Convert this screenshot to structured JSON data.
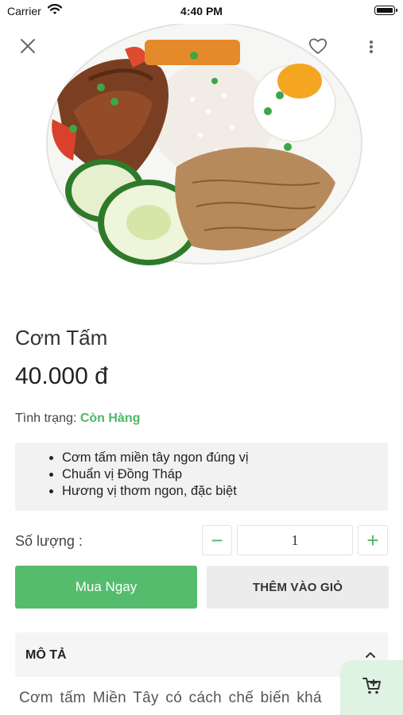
{
  "status_bar": {
    "carrier": "Carrier",
    "time": "4:40 PM"
  },
  "product": {
    "name": "Cơm Tấm",
    "price": "40.000 đ",
    "stock_label": "Tình trạng: ",
    "stock_value": "Còn Hàng",
    "highlights": [
      "Cơm tấm miền tây ngon đúng vị",
      "Chuẩn vị Đồng Tháp",
      "Hương vị thơm ngon, đặc biệt"
    ]
  },
  "quantity": {
    "label": "Số lượng :",
    "value": "1",
    "minus": "−",
    "plus": "+"
  },
  "actions": {
    "buy_now": "Mua Ngay",
    "add_to_cart": "THÊM VÀO GIỎ"
  },
  "description": {
    "title": "MÔ TẢ",
    "text": "Cơm tấm Miền Tây có cách chế biến khá"
  },
  "colors": {
    "accent": "#55bc6e",
    "stock_green": "#4cb866",
    "cart_fab_bg": "#dff3e3"
  },
  "icons": [
    "close-icon",
    "heart-icon",
    "more-vertical-icon",
    "chevron-up-icon",
    "cart-add-icon",
    "wifi-icon",
    "battery-icon"
  ]
}
